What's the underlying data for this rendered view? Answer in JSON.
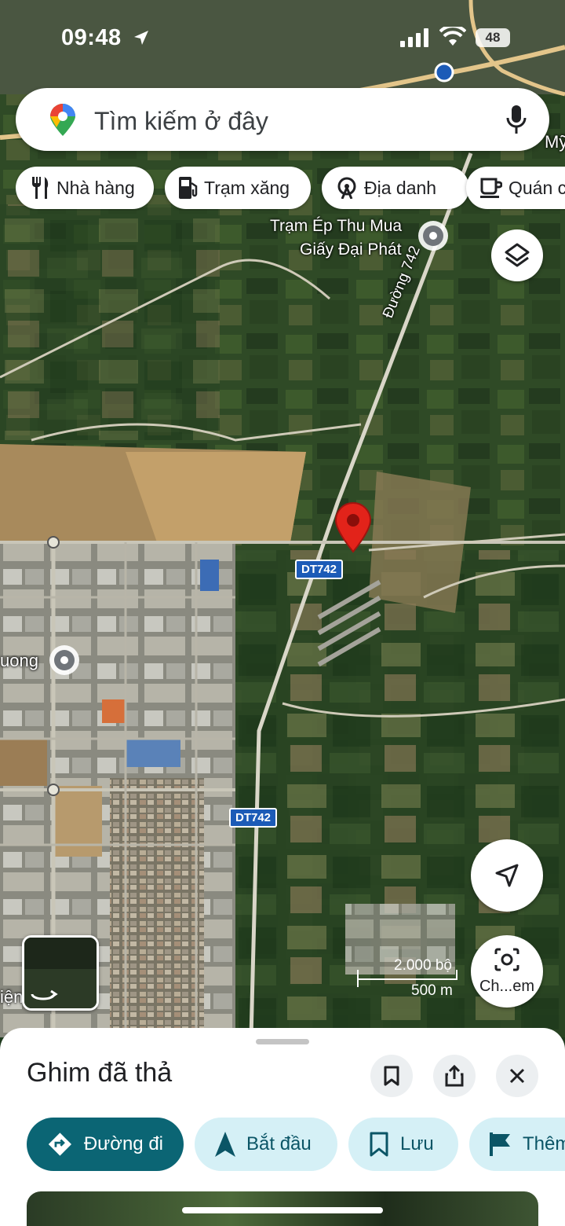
{
  "status_bar": {
    "time": "09:48",
    "battery": "48"
  },
  "search": {
    "placeholder": "Tìm kiếm ở đây"
  },
  "chips": [
    {
      "label": "Nhà hàng",
      "icon": "fork-knife-icon"
    },
    {
      "label": "Trạm xăng",
      "icon": "gas-pump-icon"
    },
    {
      "label": "Địa danh",
      "icon": "landmark-icon"
    },
    {
      "label": "Quán c",
      "icon": "coffee-cup-icon"
    }
  ],
  "map": {
    "labels": {
      "poi_name_line1": "Trạm Ép Thu Mua",
      "poi_name_line2": "Giấy Đại Phát",
      "road_name": "Đường 742",
      "partial_left": "uong",
      "partial_topright": "Mỹ",
      "partial_bottom_left": "iện"
    },
    "road_badges": [
      "DT742",
      "DT742"
    ],
    "scale": {
      "feet": "2.000 bộ",
      "meters": "500 m"
    },
    "lens_label": "Ch...em"
  },
  "sheet": {
    "title": "Ghim đã thả",
    "actions": [
      {
        "label": "Đường đi",
        "icon": "directions-icon"
      },
      {
        "label": "Bắt đầu",
        "icon": "navigation-arrow-icon"
      },
      {
        "label": "Lưu",
        "icon": "bookmark-icon"
      },
      {
        "label": "Thêm",
        "icon": "flag-icon"
      }
    ]
  },
  "colors": {
    "accent": "#0b6574",
    "secondary_chip": "#d5f0f6",
    "pin": "#e2231a",
    "road_badge": "#1c5bb7"
  }
}
